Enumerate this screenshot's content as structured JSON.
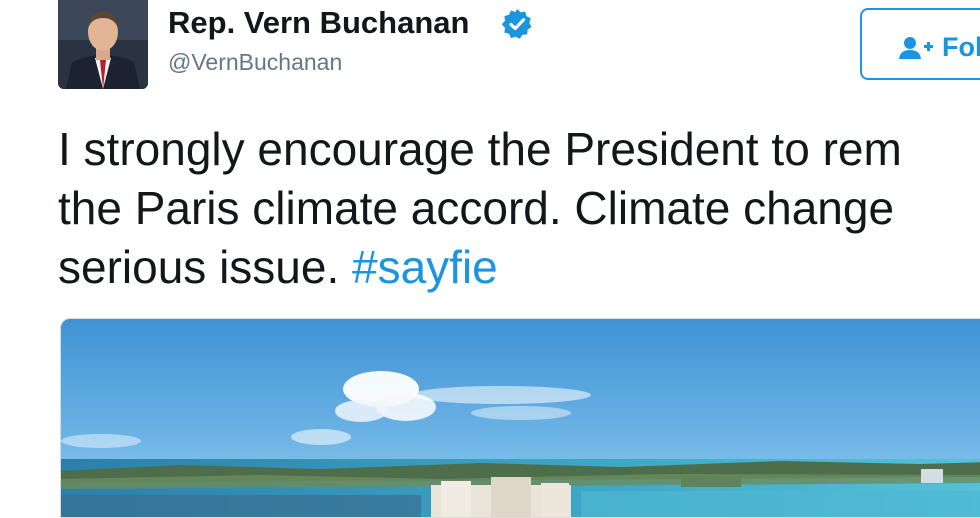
{
  "tweet": {
    "author": {
      "name": "Rep. Vern Buchanan",
      "handle": "@VernBuchanan",
      "verified": true,
      "avatar_icon": "profile-photo"
    },
    "follow_button": {
      "label": "Fol",
      "icon": "add-user-icon"
    },
    "text_lines": [
      "I strongly encourage the President to rem",
      "the Paris climate accord. Climate change",
      "serious issue. "
    ],
    "hashtag": "#sayfie",
    "media": {
      "type": "photo",
      "icon": "coastal-landscape-photo"
    }
  },
  "colors": {
    "accent": "#1b95e0",
    "text": "#14171a",
    "secondary_text": "#657786"
  }
}
